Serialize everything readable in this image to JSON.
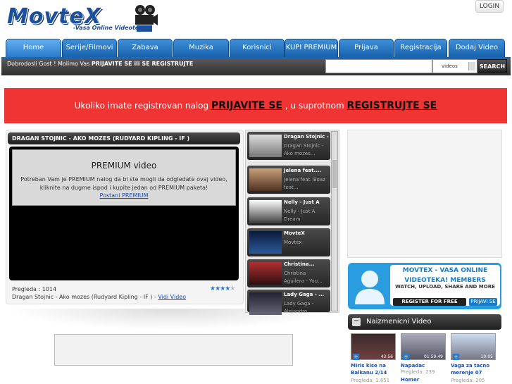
{
  "header": {
    "logo_text": "MovteX",
    "logo_subtitle": "-Vasa Online Videoteka-",
    "login_label": "LOGIN"
  },
  "nav": {
    "tabs": [
      {
        "label": "Home"
      },
      {
        "label": "Serije/Filmovi"
      },
      {
        "label": "Zabava"
      },
      {
        "label": "Muzika"
      },
      {
        "label": "Korisnici"
      },
      {
        "label": "KUPI PREMIUM"
      },
      {
        "label": "Prijava"
      },
      {
        "label": "Registracija"
      },
      {
        "label": "Dodaj Video"
      }
    ]
  },
  "subbar": {
    "welcome_prefix": "Dobrodosli Gost ! Molimo Vas",
    "welcome_bold": "PRIJAVITE SE ili SE REGISTRUJTE",
    "search_placeholder": "",
    "search_scope": "videos",
    "search_button": "SEARCH"
  },
  "notice": {
    "prefix": "Ukoliko imate registrovan nalog",
    "link1": "PRIJAVITE SE",
    "middle": ", u suprotnom",
    "link2": "REGISTRUJTE SE"
  },
  "video": {
    "title": "DRAGAN STOJNIC - AKO MOZES (RUDYARD KIPLING - IF )",
    "premium_title": "PREMIUM video",
    "premium_text": "Potreban Vam je PREMIUM nalog da bi ste mogli da odgledate ovaj video, kliknite na dugme ispod i kupite jedan od PREMIUM paketa!",
    "premium_link": "Postani PREMIUM",
    "views_label": "Pregleda : 1014",
    "rating": 4,
    "description": "Dragan Stojnic - Ako mozes (Rudyard Kipling - IF ) -",
    "view_link": "Vidi Video"
  },
  "related": [
    {
      "title": "Dragan Stojnic - ...",
      "desc": "Dragan Stojnic - Ako mozes..."
    },
    {
      "title": "Jelena feat....",
      "desc": "Jelena feat. Boaz feat..."
    },
    {
      "title": "Nelly - Just A",
      "desc": "Nelly - Just A Dream"
    },
    {
      "title": "MovteX",
      "desc": "Movtex"
    },
    {
      "title": "Christina...",
      "desc": "Christina Aguilera - You..."
    },
    {
      "title": "Lady Gaga - ...",
      "desc": "Lady Gaga - Alejandro"
    }
  ],
  "promo": {
    "line1": "MOVTEX - VASA ONLINE",
    "line2": "VIDEOTEKA! MEMBERS",
    "line3": "WATCH, UPLOAD, SHARE AND MORE",
    "register_button": "REGISTER FOR FREE",
    "login_button": "PRIJAVI SE"
  },
  "random_videos": {
    "heading": "Naizmenicni Video",
    "items": [
      {
        "title": "Miris kise na Balkanu 2/14",
        "duration": "43:56",
        "views": "Pregleda: 1.651"
      },
      {
        "title": "Napadac",
        "duration": "01:59:49",
        "views": "Pregleda: 239",
        "extra": "Homer"
      },
      {
        "title": "Vaga za tacno merenje 07",
        "duration": "10:05",
        "views": "Pregleda: 205"
      }
    ]
  },
  "colors": {
    "nav_blue": "#1962ad",
    "notice_red": "#f03434",
    "link_blue": "#1a4fb5"
  }
}
